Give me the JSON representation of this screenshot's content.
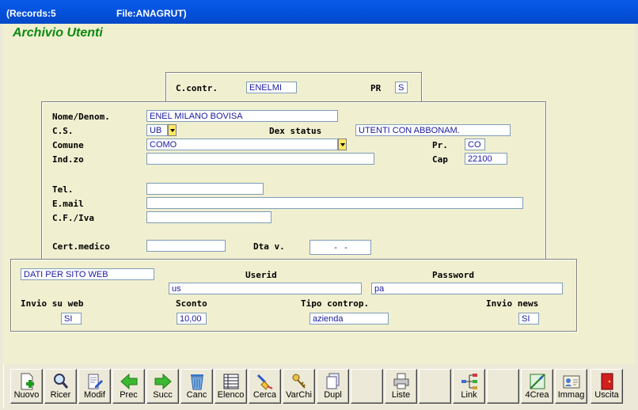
{
  "window": {
    "records": "(Records:5",
    "file": "File:ANAGRUT)"
  },
  "app_title": "Archivio Utenti",
  "header_panel": {
    "ccontr_label": "C.contr.",
    "ccontr_value": "ENELMI",
    "pr_label": "PR",
    "pr_value": "S"
  },
  "main_panel": {
    "nome_label": "Nome/Denom.",
    "nome_value": "ENEL MILANO BOVISA",
    "cs_label": "C.S.",
    "cs_value": "UB",
    "dex_label": "Dex status",
    "dex_value": "UTENTI CON ABBONAM.",
    "comune_label": "Comune",
    "comune_value": "COMO",
    "pr_label": "Pr.",
    "pr_value": "CO",
    "indzo_label": "Ind.zo",
    "indzo_value": "",
    "cap_label": "Cap",
    "cap_value": "22100",
    "tel_label": "Tel.",
    "tel_value": "",
    "email_label": "E.mail",
    "email_value": "",
    "cf_label": "C.F./Iva",
    "cf_value": "",
    "cert_label": "Cert.medico",
    "cert_value": "",
    "dtav_label": "Dta v.",
    "dtav_value": "  -   -  "
  },
  "web_panel": {
    "section_value": "DATI PER SITO WEB",
    "userid_label": "Userid",
    "userid_value": "us",
    "password_label": "Password",
    "password_value": "pa",
    "invio_web_label": "Invio su web",
    "invio_web_value": "SI",
    "sconto_label": "Sconto",
    "sconto_value": "10,00",
    "tipo_label": "Tipo controp.",
    "tipo_value": "azienda",
    "news_label": "Invio news",
    "news_value": "SI"
  },
  "toolbar": {
    "buttons": [
      {
        "label": "Nuovo",
        "icon": "new-document-icon"
      },
      {
        "label": "Ricer",
        "icon": "magnifier-icon"
      },
      {
        "label": "Modif",
        "icon": "edit-document-icon"
      },
      {
        "label": "Prec",
        "icon": "arrow-left-icon"
      },
      {
        "label": "Succ",
        "icon": "arrow-right-icon"
      },
      {
        "label": "Canc",
        "icon": "trash-icon"
      },
      {
        "label": "Elenco",
        "icon": "list-icon"
      },
      {
        "label": "Cerca",
        "icon": "search-brush-icon"
      },
      {
        "label": "VarChi",
        "icon": "keys-icon"
      },
      {
        "label": "Dupl",
        "icon": "duplicate-icon"
      },
      {
        "label": "",
        "icon": ""
      },
      {
        "label": "Liste",
        "icon": "printer-icon"
      },
      {
        "label": "",
        "icon": ""
      },
      {
        "label": "Link",
        "icon": "network-icon"
      },
      {
        "label": "",
        "icon": ""
      },
      {
        "label": "4Crea",
        "icon": "create-icon"
      },
      {
        "label": "Immag",
        "icon": "id-card-icon"
      },
      {
        "label": "",
        "icon": ""
      },
      {
        "label": "Uscita",
        "icon": "exit-door-icon"
      }
    ]
  },
  "colors": {
    "title_green": "#0a8a10",
    "field_text": "#1a1aa0",
    "form_bg": "#f0efd0",
    "titlebar": "#0553e0"
  }
}
